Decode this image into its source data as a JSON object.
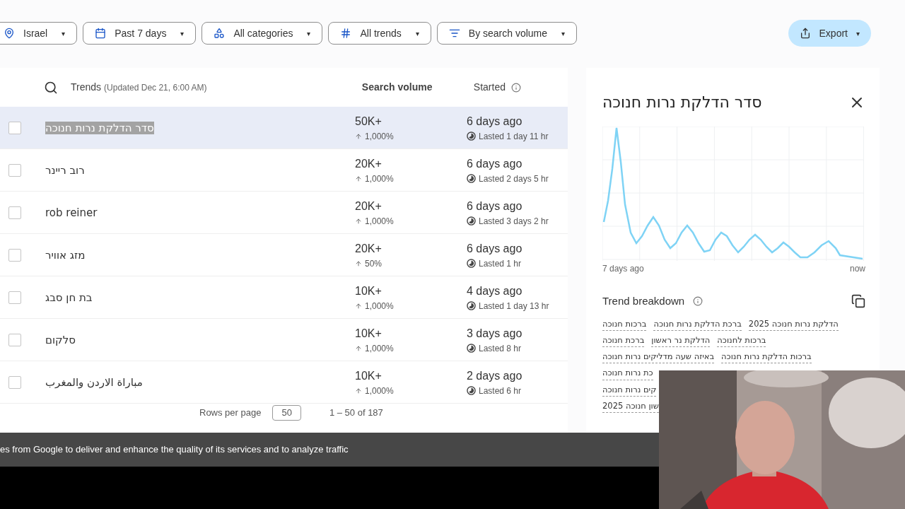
{
  "filters": [
    {
      "kind": "location",
      "label": "Israel",
      "caret": "▾"
    },
    {
      "kind": "date",
      "label": "Past 7 days",
      "caret": "▾"
    },
    {
      "kind": "category",
      "label": "All categories",
      "caret": "▾"
    },
    {
      "kind": "trend",
      "label": "All trends",
      "caret": "▾"
    },
    {
      "kind": "sort",
      "label": "By search volume",
      "caret": "▾"
    }
  ],
  "export": {
    "label": "Export",
    "caret": "▾"
  },
  "table": {
    "columns": {
      "trends": "Trends",
      "updated": "(Updated Dec 21, 6:00 AM)",
      "volume": "Search volume",
      "started": "Started"
    },
    "rows": [
      {
        "name": "סדר הדלקת נרות חנוכה",
        "selected": true,
        "checked": false,
        "volume": "50K+",
        "change": "1,000%",
        "started": "6 days ago",
        "lasted": "Lasted 1 day 11 hr"
      },
      {
        "name": "רוב ריינר",
        "selected": false,
        "checked": false,
        "volume": "20K+",
        "change": "1,000%",
        "started": "6 days ago",
        "lasted": "Lasted 2 days 5 hr"
      },
      {
        "name": "rob reiner",
        "selected": false,
        "checked": false,
        "volume": "20K+",
        "change": "1,000%",
        "started": "6 days ago",
        "lasted": "Lasted 3 days 2 hr"
      },
      {
        "name": "מזג אוויר",
        "selected": false,
        "checked": false,
        "volume": "20K+",
        "change": "50%",
        "started": "6 days ago",
        "lasted": "Lasted 1 hr"
      },
      {
        "name": "בת חן סבג",
        "selected": false,
        "checked": false,
        "volume": "10K+",
        "change": "1,000%",
        "started": "4 days ago",
        "lasted": "Lasted 1 day 13 hr"
      },
      {
        "name": "סלקום",
        "selected": false,
        "checked": false,
        "volume": "10K+",
        "change": "1,000%",
        "started": "3 days ago",
        "lasted": "Lasted 8 hr"
      },
      {
        "name": "مباراة الاردن والمغرب",
        "selected": false,
        "checked": false,
        "volume": "10K+",
        "change": "1,000%",
        "started": "2 days ago",
        "lasted": "Lasted 6 hr"
      }
    ],
    "pagination": {
      "rows_per_page_label": "Rows per page",
      "rows_per_page": "50",
      "range": "1 – 50 of 187"
    }
  },
  "detail": {
    "title": "סדר הדלקת נרות חנוכה",
    "chart_start": "7 days ago",
    "chart_end": "now",
    "breakdown_title": "Trend breakdown",
    "tag_lines": [
      [
        "הדלקת נרות חנוכה 2025",
        "ברכת הדלקת נרות חנוכה",
        "ברכות חנוכה"
      ],
      [
        "ברכות לחנוכה",
        "הדלקת נר ראשון",
        "ברכת חנוכה"
      ],
      [
        "ברכות הדלקת נרות חנוכה",
        "באיזה שעה מדליקים נרות חנוכה"
      ],
      [
        "כת נרות חנוכה"
      ],
      [
        "קים נרות חנוכה"
      ],
      [
        "שון חנוכה 2025"
      ]
    ]
  },
  "cookie_banner": "es from Google to deliver and enhance the quality of its services and to analyze traffic"
}
